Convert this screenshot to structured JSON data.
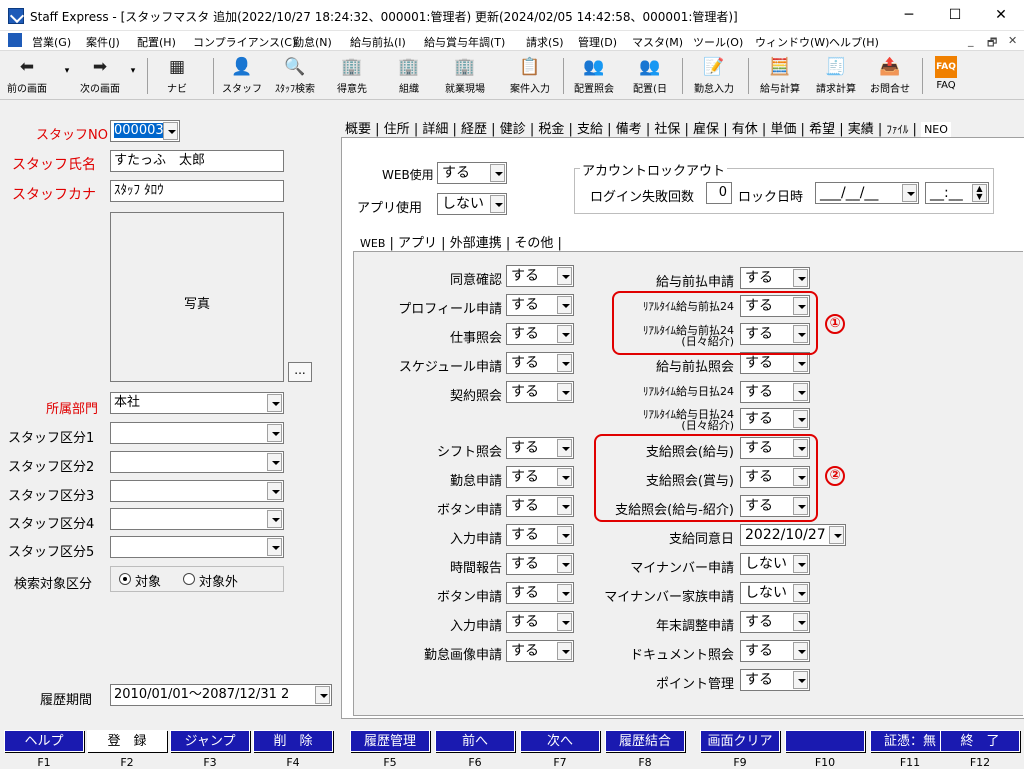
{
  "window": {
    "title": "Staff Express - [スタッフマスタ 追加(2022/10/27 18:24:32、000001:管理者) 更新(2024/02/05 14:42:58、000001:管理者)]",
    "minimize": "─",
    "maximize": "☐",
    "close": "✕"
  },
  "menu": {
    "items": [
      "営業(G)",
      "案件(J)",
      "配置(H)",
      "コンプライアンス(C)",
      "勤怠(N)",
      "給与前払(I)",
      "給与賞与年調(T)",
      "請求(S)",
      "管理(D)",
      "マスタ(M)",
      "ツール(O)",
      "ウィンドウ(W)",
      "ヘルプ(H)"
    ],
    "mdi_controls": [
      "_",
      "🗗",
      "✕"
    ]
  },
  "toolbar": {
    "buttons": [
      {
        "label": "前の画面",
        "icon": "arrow-left-icon",
        "glyph": "⬅"
      },
      {
        "label": "次の画面",
        "icon": "arrow-right-icon",
        "glyph": "➡"
      },
      {
        "label": "ナビ",
        "icon": "navi-icon",
        "glyph": "▦"
      },
      {
        "label": "スタッフ",
        "icon": "staff-icon",
        "glyph": "👤"
      },
      {
        "label": "ｽﾀｯﾌ検索",
        "icon": "staff-search-icon",
        "glyph": "🔍"
      },
      {
        "label": "得意先",
        "icon": "customer-icon",
        "glyph": "🏢"
      },
      {
        "label": "組織",
        "icon": "organization-icon",
        "glyph": "🏢"
      },
      {
        "label": "就業現場",
        "icon": "worksite-icon",
        "glyph": "🏢"
      },
      {
        "label": "案件入力",
        "icon": "job-entry-icon",
        "glyph": "📋"
      },
      {
        "label": "配置照会",
        "icon": "assignment-inquiry-icon",
        "glyph": "👥"
      },
      {
        "label": "配置(日",
        "icon": "assignment-daily-icon",
        "glyph": "👥"
      },
      {
        "label": "勤怠入力",
        "icon": "attendance-entry-icon",
        "glyph": "📝"
      },
      {
        "label": "給与計算",
        "icon": "payroll-icon",
        "glyph": "🧮"
      },
      {
        "label": "請求計算",
        "icon": "billing-icon",
        "glyph": "🧾"
      },
      {
        "label": "お問合せ",
        "icon": "inquiry-icon",
        "glyph": "📤"
      },
      {
        "label": "FAQ",
        "icon": "faq-icon",
        "glyph": "FAQ"
      }
    ]
  },
  "left": {
    "staff_no_label": "スタッフNO",
    "staff_no_value": "000003",
    "staff_name_label": "スタッフ氏名",
    "staff_name_value": "すたっふ　太郎",
    "staff_kana_label": "スタッフカナ",
    "staff_kana_value": "ｽﾀｯﾌ ﾀﾛｳ",
    "photo_label": "写真",
    "photo_button": "...",
    "dept_label": "所属部門",
    "dept_value": "本社",
    "class1_label": "スタッフ区分1",
    "class2_label": "スタッフ区分2",
    "class3_label": "スタッフ区分3",
    "class4_label": "スタッフ区分4",
    "class5_label": "スタッフ区分5",
    "search_label": "検索対象区分",
    "search_opt1": "対象",
    "search_opt2": "対象外",
    "history_label": "履歴期間",
    "history_value": "2010/01/01～2087/12/31 2"
  },
  "outer_tabs": [
    "概要",
    "住所",
    "詳細",
    "経歴",
    "健診",
    "税金",
    "支給",
    "備考",
    "社保",
    "雇保",
    "有休",
    "単価",
    "希望",
    "実績",
    "ﾌｧｲﾙ",
    "NEO"
  ],
  "neo": {
    "web_use_label": "WEB使用",
    "web_use_value": "する",
    "app_use_label": "アプリ使用",
    "app_use_value": "しない",
    "lockout_title": "アカウントロックアウト",
    "login_fail_label": "ログイン失敗回数",
    "login_fail_value": "0",
    "lock_date_label": "ロック日時",
    "lock_date_value": "___/__/__",
    "lock_time_value": "__:__"
  },
  "inner_tabs": [
    "WEB",
    "アプリ",
    "外部連携",
    "その他"
  ],
  "web_left": [
    {
      "label": "同意確認",
      "value": "する"
    },
    {
      "label": "プロフィール申請",
      "value": "する"
    },
    {
      "label": "仕事照会",
      "value": "する"
    },
    {
      "label": "スケジュール申請",
      "value": "する"
    },
    {
      "label": "契約照会",
      "value": "する"
    },
    {
      "label": "シフト照会",
      "value": "する"
    },
    {
      "label": "勤怠申請",
      "value": "する"
    },
    {
      "label": "ボタン申請",
      "value": "する"
    },
    {
      "label": "入力申請",
      "value": "する"
    },
    {
      "label": "時間報告",
      "value": "する"
    },
    {
      "label": "ボタン申請",
      "value": "する"
    },
    {
      "label": "入力申請",
      "value": "する"
    },
    {
      "label": "勤怠画像申請",
      "value": "する"
    }
  ],
  "web_right": [
    {
      "label": "給与前払申請",
      "value": "する"
    },
    {
      "label": "ﾘｱﾙﾀｲﾑ給与前払24",
      "value": "する"
    },
    {
      "label": "ﾘｱﾙﾀｲﾑ給与前払24\n(日々紹介)",
      "value": "する"
    },
    {
      "label": "給与前払照会",
      "value": "する"
    },
    {
      "label": "ﾘｱﾙﾀｲﾑ給与日払24",
      "value": "する"
    },
    {
      "label": "ﾘｱﾙﾀｲﾑ給与日払24\n(日々紹介)",
      "value": "する"
    },
    {
      "label": "支給照会(給与)",
      "value": "する"
    },
    {
      "label": "支給照会(賞与)",
      "value": "する"
    },
    {
      "label": "支給照会(給与-紹介)",
      "value": "する"
    },
    {
      "label": "支給同意日",
      "value": "2022/10/27"
    },
    {
      "label": "マイナンバー申請",
      "value": "しない"
    },
    {
      "label": "マイナンバー家族申請",
      "value": "しない"
    },
    {
      "label": "年末調整申請",
      "value": "する"
    },
    {
      "label": "ドキュメント照会",
      "value": "する"
    },
    {
      "label": "ポイント管理",
      "value": "する"
    }
  ],
  "annotations": {
    "one": "①",
    "two": "②"
  },
  "fkeys": [
    {
      "label": "ヘルプ",
      "key": "F1"
    },
    {
      "label": "登　録",
      "key": "F2"
    },
    {
      "label": "ジャンプ",
      "key": "F3"
    },
    {
      "label": "削　除",
      "key": "F4"
    },
    {
      "label": "履歴管理",
      "key": "F5"
    },
    {
      "label": "前へ",
      "key": "F6"
    },
    {
      "label": "次へ",
      "key": "F7"
    },
    {
      "label": "履歴結合",
      "key": "F8"
    },
    {
      "label": "画面クリア",
      "key": "F9"
    },
    {
      "label": "",
      "key": "F10"
    },
    {
      "label": "証憑：無",
      "key": "F11"
    },
    {
      "label": "終　了",
      "key": "F12"
    }
  ]
}
